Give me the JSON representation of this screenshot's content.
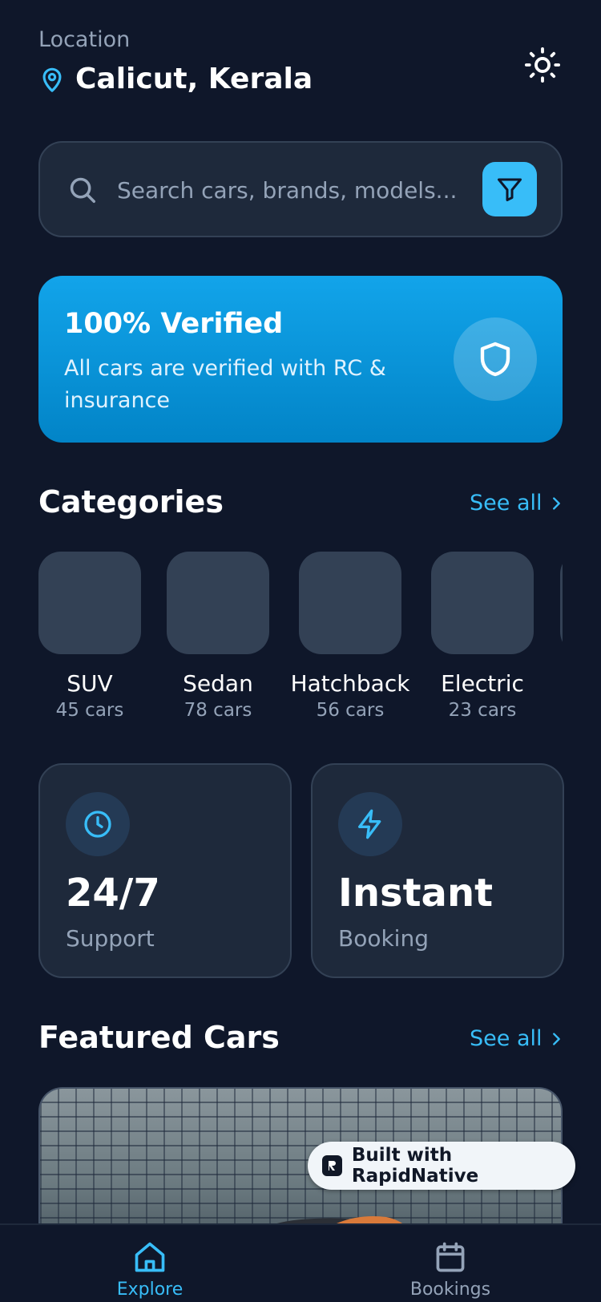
{
  "header": {
    "location_label": "Location",
    "location_value": "Calicut, Kerala",
    "location_icon": "map-pin-icon",
    "theme_icon": "sun-icon"
  },
  "search": {
    "placeholder": "Search cars, brands, models...",
    "value": "",
    "search_icon": "search-icon",
    "filter_icon": "filter-icon"
  },
  "verified_banner": {
    "title": "100% Verified",
    "description": "All cars are verified with RC & insurance",
    "icon": "shield-icon"
  },
  "categories": {
    "title": "Categories",
    "see_all": "See all",
    "items": [
      {
        "name": "SUV",
        "count": "45 cars"
      },
      {
        "name": "Sedan",
        "count": "78 cars"
      },
      {
        "name": "Hatchback",
        "count": "56 cars"
      },
      {
        "name": "Electric",
        "count": "23 cars"
      }
    ]
  },
  "stats": [
    {
      "value": "24/7",
      "label": "Support",
      "icon": "clock-icon"
    },
    {
      "value": "Instant",
      "label": "Booking",
      "icon": "lightning-icon"
    }
  ],
  "featured": {
    "title": "Featured Cars",
    "see_all": "See all"
  },
  "badge": {
    "text": "Built with RapidNative"
  },
  "bottom_nav": {
    "items": [
      {
        "label": "Explore",
        "icon": "home-icon",
        "active": true
      },
      {
        "label": "Bookings",
        "icon": "calendar-icon",
        "active": false
      }
    ]
  },
  "colors": {
    "background": "#0f172a",
    "surface": "#1e293b",
    "accent": "#38bdf8",
    "banner": "#0ea5e9",
    "muted_text": "#94a3b8"
  }
}
